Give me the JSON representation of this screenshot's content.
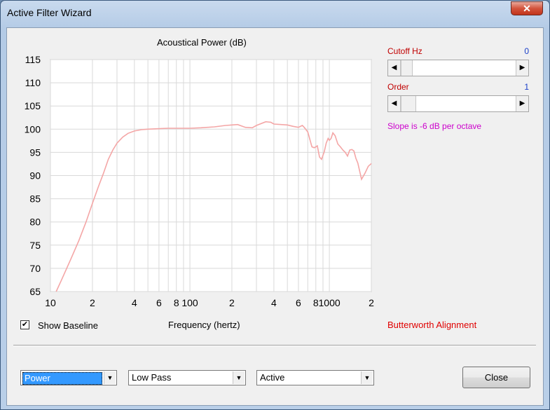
{
  "window": {
    "title": "Active Filter Wizard",
    "close_glyph": "✕"
  },
  "controls": {
    "cutoff_label": "Cutoff  Hz",
    "cutoff_value": "0",
    "cutoff_slider_position": 0,
    "order_label": "Order",
    "order_value": "1",
    "order_slider_position": 0,
    "slope_text": "Slope is -6 dB per octave",
    "left_arrow": "◀",
    "right_arrow": "▶"
  },
  "footer": {
    "show_baseline_label": "Show Baseline",
    "show_baseline_checked": true,
    "check_glyph": "✔",
    "frequency_label": "Frequency (hertz)",
    "alignment_label": "Butterworth Alignment",
    "dropdowns": [
      {
        "value": "Power",
        "selected": true
      },
      {
        "value": "Low Pass",
        "selected": false
      },
      {
        "value": "Active",
        "selected": false
      }
    ],
    "drop_glyph": "▼",
    "close_button": "Close"
  },
  "colors": {
    "curve": "#f4a6a6",
    "grid": "#d9d9d9",
    "accent_red": "#c00000",
    "accent_blue": "#1a3ec8",
    "slope_magenta": "#cc00cc"
  },
  "chart_data": {
    "type": "line",
    "title": "Acoustical Power (dB)",
    "xlabel": "Frequency (hertz)",
    "ylabel": "",
    "x_scale": "log",
    "xlim": [
      10,
      2000
    ],
    "ylim": [
      65,
      115
    ],
    "x_tick_labels": [
      {
        "value": 10,
        "label": "10"
      },
      {
        "value": 20,
        "label": "2"
      },
      {
        "value": 40,
        "label": "4"
      },
      {
        "value": 60,
        "label": "6"
      },
      {
        "value": 80,
        "label": "8"
      },
      {
        "value": 100,
        "label": "100"
      },
      {
        "value": 200,
        "label": "2"
      },
      {
        "value": 400,
        "label": "4"
      },
      {
        "value": 600,
        "label": "6"
      },
      {
        "value": 800,
        "label": "8"
      },
      {
        "value": 1000,
        "label": "1000"
      },
      {
        "value": 2000,
        "label": "2"
      }
    ],
    "y_ticks": [
      65,
      70,
      75,
      80,
      85,
      90,
      95,
      100,
      105,
      110,
      115
    ],
    "grid": true,
    "series": [
      {
        "x": [
          11,
          12,
          14,
          16,
          18,
          20,
          22,
          24,
          26,
          28,
          30,
          33,
          36,
          40,
          45,
          50,
          60,
          70,
          80,
          100,
          120,
          150,
          180,
          200,
          220,
          250,
          280,
          300,
          350,
          380,
          400,
          450,
          500,
          550,
          600,
          640,
          660,
          700,
          750,
          780,
          820,
          850,
          880,
          920,
          950,
          980,
          1000,
          1030,
          1060,
          1100,
          1150,
          1200,
          1250,
          1300,
          1350,
          1400,
          1450,
          1500,
          1550,
          1600,
          1700,
          1800,
          1900,
          2000
        ],
        "y": [
          65,
          67.5,
          72,
          76,
          80,
          84,
          87.5,
          90.5,
          93.5,
          95.5,
          97,
          98.3,
          99.1,
          99.6,
          99.9,
          100,
          100.1,
          100.2,
          100.2,
          100.2,
          100.3,
          100.5,
          100.8,
          100.9,
          101,
          100.4,
          100.3,
          100.8,
          101.6,
          101.5,
          101.1,
          101,
          100.9,
          100.6,
          100.4,
          100.8,
          100.4,
          99.4,
          96.2,
          96,
          96.4,
          94,
          93.5,
          95.2,
          97,
          98,
          97.6,
          98,
          99.2,
          98.6,
          96.8,
          96.2,
          95.5,
          95,
          94.2,
          95.5,
          95.6,
          95.3,
          93.7,
          92.7,
          89.2,
          90.5,
          92,
          92.6
        ]
      }
    ]
  }
}
